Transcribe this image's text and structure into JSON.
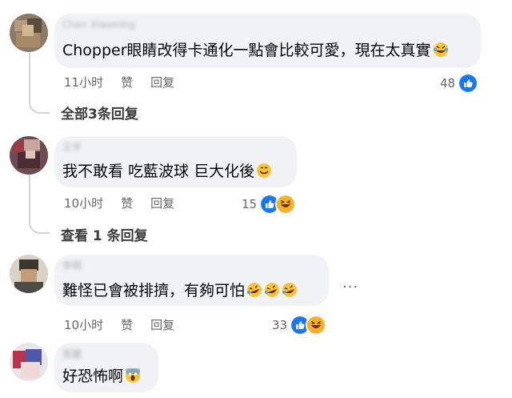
{
  "comments": [
    {
      "author": "Chen Xiaoming",
      "text": "Chopper眼睛改得卡通化一點會比較可愛，現在太真實",
      "emoji": "laugh-tears",
      "time": "11小时",
      "like": "赞",
      "reply": "回复",
      "reaction_count": "48",
      "reactions": [
        "like"
      ],
      "replies_link": "全部3条回复"
    },
    {
      "author": "王宇",
      "text": "我不敢看 吃藍波球 巨大化後",
      "emoji": "smile",
      "time": "10小时",
      "like": "赞",
      "reply": "回复",
      "reaction_count": "15",
      "reactions": [
        "like",
        "haha"
      ],
      "replies_link": "查看 1 条回复"
    },
    {
      "author": "李明",
      "text": "難怪已會被排擠，有夠可怕",
      "emoji": "rofl",
      "time": "10小时",
      "like": "赞",
      "reply": "回复",
      "reaction_count": "33",
      "reactions": [
        "like",
        "haha"
      ],
      "more": "···"
    },
    {
      "author": "張麗",
      "text": "好恐怖啊",
      "emoji": "scream"
    }
  ],
  "colors": {
    "bubble": "#f0f2f5",
    "like_blue": "#1877f2",
    "haha_yellow": "#f7b125",
    "muted": "#65676b"
  }
}
